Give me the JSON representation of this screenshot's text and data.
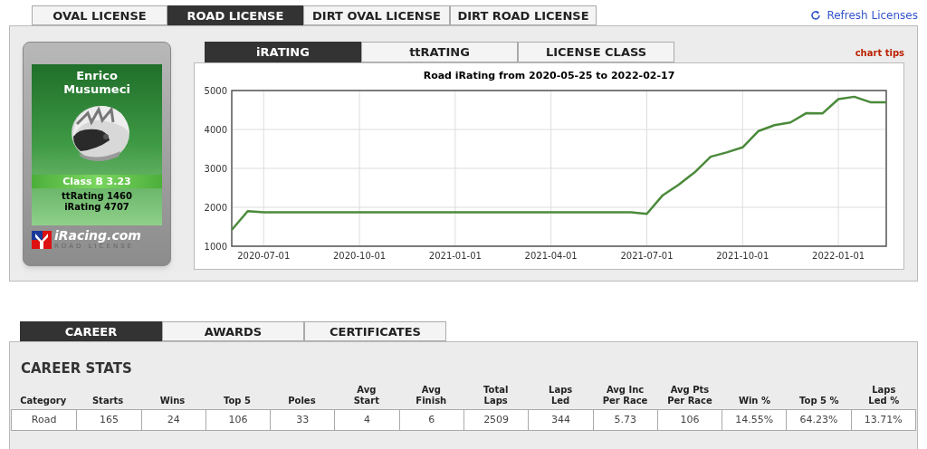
{
  "license_tabs": [
    {
      "label": "OVAL LICENSE",
      "selected": false
    },
    {
      "label": "ROAD LICENSE",
      "selected": true
    },
    {
      "label": "DIRT OVAL LICENSE",
      "selected": false
    },
    {
      "label": "DIRT ROAD LICENSE",
      "selected": false
    }
  ],
  "refresh_link": "Refresh Licenses",
  "license_card": {
    "name": "Enrico Musumeci",
    "class": "Class B 3.23",
    "tt_rating": "ttRating 1460",
    "i_rating": "iRating 4707",
    "logo_text": "iRacing.com",
    "logo_subtitle": "ROAD LICENSE"
  },
  "chart_tabs": [
    {
      "label": "iRATING",
      "selected": true
    },
    {
      "label": "ttRATING",
      "selected": false
    },
    {
      "label": "LICENSE CLASS",
      "selected": false
    }
  ],
  "chart_tips": "chart tips",
  "chart_data": {
    "type": "line",
    "grid": true,
    "title": "Road iRating from 2020-05-25 to 2022-02-17",
    "ylim": [
      1000,
      5000
    ],
    "yticks": [
      1000,
      2000,
      3000,
      4000,
      5000
    ],
    "categories": [
      null,
      null,
      "2020-07-01",
      null,
      null,
      null,
      null,
      null,
      "2020-10-01",
      null,
      null,
      null,
      null,
      null,
      "2021-01-01",
      null,
      null,
      null,
      null,
      null,
      "2021-04-01",
      null,
      null,
      null,
      null,
      null,
      "2021-07-01",
      null,
      null,
      null,
      null,
      null,
      "2021-10-01",
      null,
      null,
      null,
      null,
      null,
      "2022-01-01",
      null,
      null,
      null
    ],
    "series": [
      {
        "color": "#4a8a3a",
        "values": [
          1420,
          1900,
          1870,
          1870,
          1870,
          1870,
          1870,
          1870,
          1870,
          1870,
          1870,
          1870,
          1870,
          1870,
          1870,
          1870,
          1870,
          1870,
          1870,
          1870,
          1870,
          1870,
          1870,
          1870,
          1870,
          1870,
          1830,
          2310,
          2580,
          2900,
          3300,
          3410,
          3540,
          3960,
          4110,
          4180,
          4420,
          4410,
          4780,
          4840,
          4700,
          4700
        ]
      }
    ]
  },
  "career_tabs": [
    {
      "label": "CAREER",
      "selected": true
    },
    {
      "label": "AWARDS",
      "selected": false
    },
    {
      "label": "CERTIFICATES",
      "selected": false
    }
  ],
  "career_stats": {
    "title": "CAREER STATS",
    "columns": [
      "Category",
      "Starts",
      "Wins",
      "Top 5",
      "Poles",
      "Avg\nStart",
      "Avg\nFinish",
      "Total\nLaps",
      "Laps\nLed",
      "Avg Inc\nPer Race",
      "Avg Pts\nPer Race",
      "Win %",
      "Top 5 %",
      "Laps\nLed %"
    ],
    "rows": [
      [
        "Road",
        "165",
        "24",
        "106",
        "33",
        "4",
        "6",
        "2509",
        "344",
        "5.73",
        "106",
        "14.55%",
        "64.23%",
        "13.71%"
      ]
    ]
  }
}
